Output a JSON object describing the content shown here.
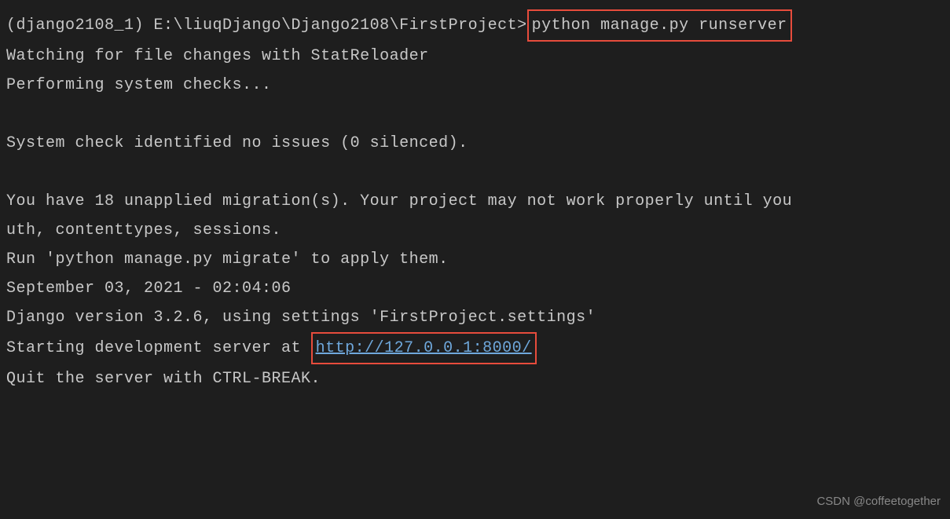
{
  "prompt": {
    "env": "(django2108_1) ",
    "path": "E:\\liuqDjango\\Django2108\\FirstProject>",
    "command": "python manage.py runserver"
  },
  "output": {
    "line1": "Watching for file changes with StatReloader",
    "line2": "Performing system checks...",
    "line3": "System check identified no issues (0 silenced).",
    "line4": "You have 18 unapplied migration(s). Your project may not work properly until you",
    "line5": "uth, contenttypes, sessions.",
    "line6": "Run 'python manage.py migrate' to apply them.",
    "line7": "September 03, 2021 - 02:04:06",
    "line8": "Django version 3.2.6, using settings 'FirstProject.settings'",
    "line9_prefix": "Starting development server at ",
    "line9_url": "http://127.0.0.1:8000/",
    "line10": "Quit the server with CTRL-BREAK."
  },
  "watermark": "CSDN @coffeetogether"
}
